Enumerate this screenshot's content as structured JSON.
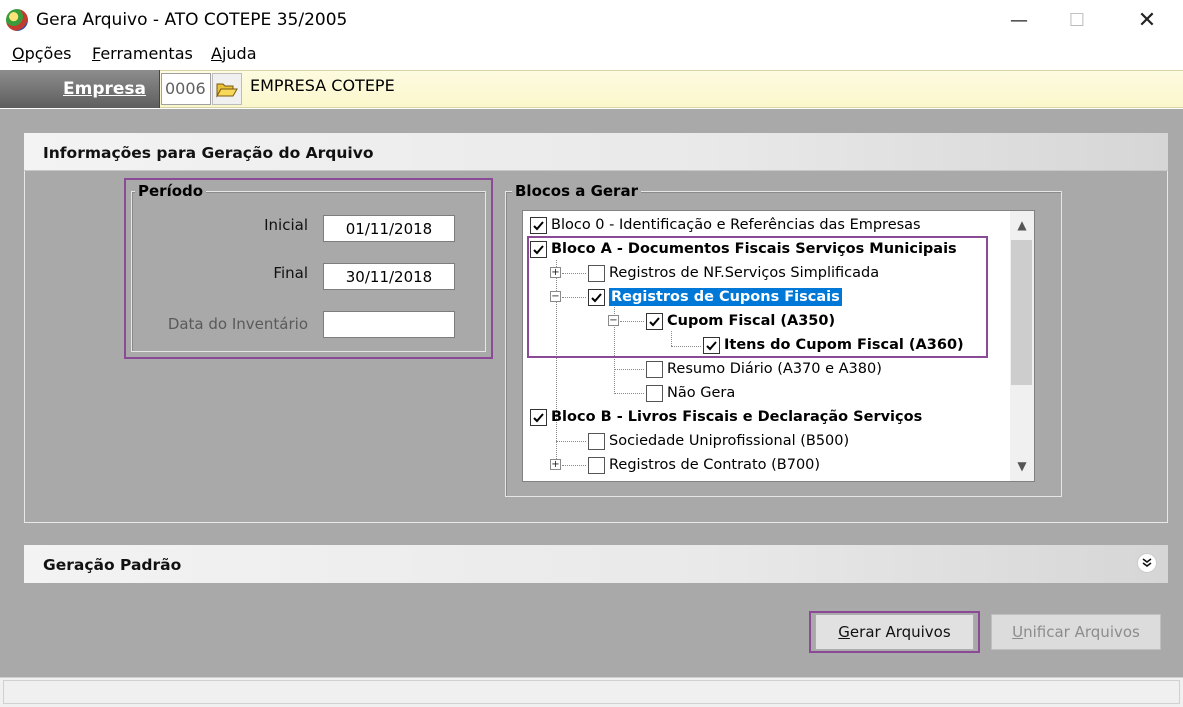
{
  "window": {
    "title": "Gera Arquivo - ATO COTEPE 35/2005",
    "controls": {
      "minimize": "—",
      "maximize": "☐",
      "close": "✕"
    }
  },
  "menu": [
    {
      "label_underlined": "O",
      "label_rest": "pções"
    },
    {
      "label_underlined": "F",
      "label_rest": "erramentas"
    },
    {
      "label_underlined": "A",
      "label_rest": "juda"
    }
  ],
  "empresa": {
    "label": "Empresa",
    "code": "0006",
    "name": "EMPRESA COTEPE"
  },
  "info_panel": {
    "title": "Informações para Geração do Arquivo",
    "periodo": {
      "legend": "Período",
      "inicial_label": "Inicial",
      "inicial_value": "01/11/2018",
      "final_label": "Final",
      "final_value": "30/11/2018",
      "inventario_label": "Data do Inventário",
      "inventario_value": ""
    },
    "blocos": {
      "legend": "Blocos a Gerar",
      "tree": [
        {
          "text": "Bloco 0 - Identificação e Referências das Empresas",
          "checked": true
        },
        {
          "text": "Bloco A - Documentos Fiscais Serviços Municipais",
          "checked": true
        },
        {
          "text": "Registros de NF.Serviços Simplificada",
          "checked": false
        },
        {
          "text": "Registros de Cupons Fiscais",
          "checked": true
        },
        {
          "text": "Cupom Fiscal  (A350)",
          "checked": true
        },
        {
          "text": "Itens do Cupom Fiscal  (A360)",
          "checked": true
        },
        {
          "text": "Resumo Diário  (A370 e A380)",
          "checked": false
        },
        {
          "text": "Não Gera",
          "checked": false
        },
        {
          "text": "Bloco B - Livros Fiscais e Declaração Serviços",
          "checked": true
        },
        {
          "text": "Sociedade Uniprofissional  (B500)",
          "checked": false
        },
        {
          "text": "Registros de Contrato  (B700)",
          "checked": false
        }
      ]
    }
  },
  "geracao": {
    "title": "Geração Padrão",
    "expand_glyph": "»"
  },
  "buttons": {
    "gerar_underlined": "G",
    "gerar_rest": "erar Arquivos",
    "unificar_underlined": "U",
    "unificar_rest": "nificar Arquivos"
  },
  "icons": {
    "app": "app-globe-icon",
    "folder": "open-folder-icon",
    "check": "checkmark-icon",
    "expand": "double-chevron-down-icon"
  },
  "colors": {
    "highlight": "#8b4a96",
    "selection": "#0078d7",
    "empresa_bar": "#fbf7cc",
    "panel_gray": "#a9a9a9"
  }
}
